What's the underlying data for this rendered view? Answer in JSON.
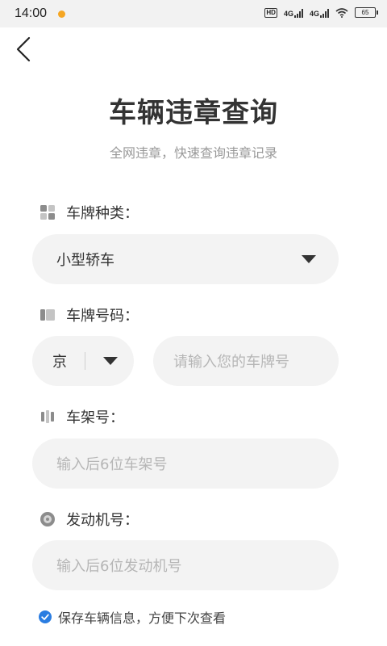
{
  "status_bar": {
    "time": "14:00",
    "hd_label": "HD",
    "network_1": "4G",
    "network_2": "4G",
    "battery": "65"
  },
  "page": {
    "title": "车辆违章查询",
    "subtitle": "全网违章，快速查询违章记录"
  },
  "plate_type": {
    "label": "车牌种类：",
    "value": "小型轿车"
  },
  "plate_number": {
    "label": "车牌号码：",
    "province": "京",
    "placeholder": "请输入您的车牌号"
  },
  "vin": {
    "label": "车架号：",
    "placeholder": "输入后6位车架号"
  },
  "engine": {
    "label": "发动机号：",
    "placeholder": "输入后6位发动机号"
  },
  "save_info": {
    "checked": true,
    "label": "保存车辆信息，方便下次查看"
  },
  "colors": {
    "accent": "#2a7de1",
    "field_bg": "#f3f3f3",
    "placeholder": "#b6b6b6"
  }
}
